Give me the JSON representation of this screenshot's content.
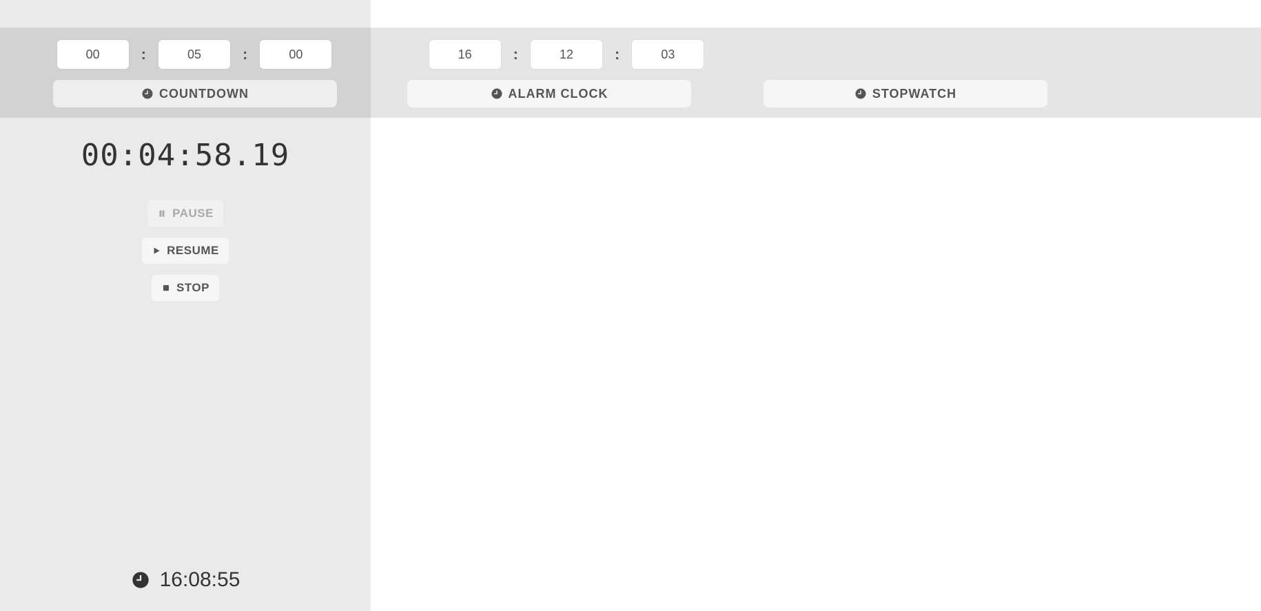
{
  "countdown": {
    "input_hours": "00",
    "input_minutes": "05",
    "input_seconds": "00",
    "button_label": "COUNTDOWN"
  },
  "alarm": {
    "input_hours": "16",
    "input_minutes": "12",
    "input_seconds": "03",
    "button_label": "ALARM CLOCK"
  },
  "stopwatch": {
    "button_label": "STOPWATCH"
  },
  "display": {
    "time": "00:04:58.19"
  },
  "controls": {
    "pause": "PAUSE",
    "resume": "RESUME",
    "stop": "STOP"
  },
  "footer": {
    "current_time": "16:08:55"
  },
  "separator": ":"
}
